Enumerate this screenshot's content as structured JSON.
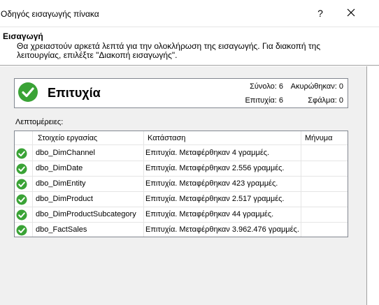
{
  "window": {
    "title": "Οδηγός εισαγωγής πίνακα",
    "help_label": "?"
  },
  "header": {
    "title": "Εισαγωγή",
    "description": "Θα χρειαστούν αρκετά λεπτά για την ολοκλήρωση της εισαγωγής. Για διακοπή της λειτουργίας, επιλέξτε \"Διακοπή εισαγωγής\"."
  },
  "summary": {
    "status": "Επιτυχία",
    "status_color": "#3aa336",
    "total": "Σύνολο: 6",
    "cancelled": "Ακυρώθηκαν: 0",
    "success": "Επιτυχία: 6",
    "errors": "Σφάλμα: 0"
  },
  "details": {
    "label": "Λεπτομέρειες:",
    "columns": [
      "Στοιχείο εργασίας",
      "Κατάσταση",
      "Μήνυμα"
    ],
    "rows": [
      {
        "icon": "success-check-icon",
        "item": "dbo_DimChannel",
        "status": "Επιτυχία. Μεταφέρθηκαν 4 γραμμές.",
        "message": ""
      },
      {
        "icon": "success-check-icon",
        "item": "dbo_DimDate",
        "status": "Επιτυχία. Μεταφέρθηκαν 2.556 γραμμές.",
        "message": ""
      },
      {
        "icon": "success-check-icon",
        "item": "dbo_DimEntity",
        "status": "Επιτυχία. Μεταφέρθηκαν 423 γραμμές.",
        "message": ""
      },
      {
        "icon": "success-check-icon",
        "item": "dbo_DimProduct",
        "status": "Επιτυχία. Μεταφέρθηκαν 2.517 γραμμές.",
        "message": ""
      },
      {
        "icon": "success-check-icon",
        "item": "dbo_DimProductSubcategory",
        "status": "Επιτυχία. Μεταφέρθηκαν 44 γραμμές.",
        "message": ""
      },
      {
        "icon": "success-check-icon",
        "item": "dbo_FactSales",
        "status": "Επιτυχία. Μεταφέρθηκαν 3.962.476 γραμμές.",
        "message": ""
      }
    ]
  }
}
